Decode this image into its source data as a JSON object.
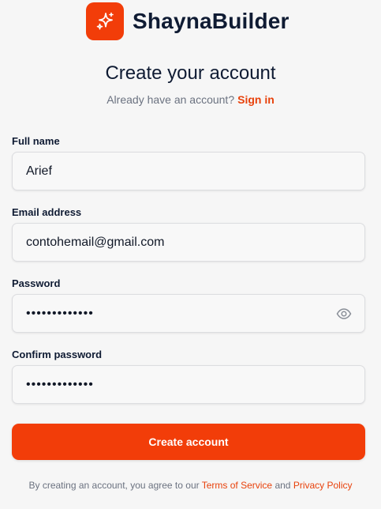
{
  "brand": {
    "name": "ShaynaBuilder",
    "logo_icon": "sparkles-icon",
    "accent": "#f23d09"
  },
  "header": {
    "title": "Create your account",
    "subtitle_text": "Already have an account?",
    "signin_link": "Sign in"
  },
  "form": {
    "full_name": {
      "label": "Full name",
      "value": "Arief"
    },
    "email": {
      "label": "Email address",
      "value": "contohemail@gmail.com"
    },
    "password": {
      "label": "Password",
      "value": "•••••••••••••",
      "toggle_icon": "eye-icon"
    },
    "confirm_password": {
      "label": "Confirm password",
      "value": "•••••••••••••"
    },
    "submit_label": "Create account"
  },
  "footer": {
    "prefix": "By creating an account, you agree to our",
    "terms_link": "Terms of Service",
    "and": "and",
    "privacy_link": "Privacy Policy"
  }
}
